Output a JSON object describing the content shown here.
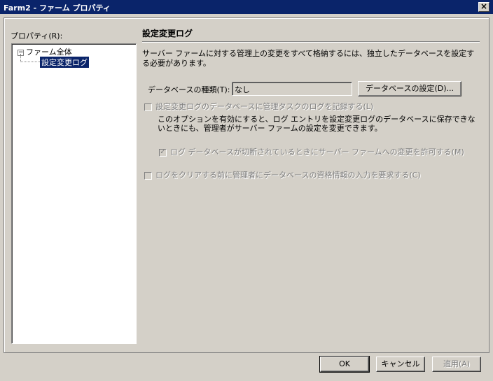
{
  "window": {
    "title": "Farm2 - ファーム プロパティ",
    "close_glyph": "×"
  },
  "left": {
    "label": "プロパティ(R):",
    "tree": {
      "root_label": "ファーム全体",
      "expander": "−",
      "child_label": "設定変更ログ"
    }
  },
  "main": {
    "title": "設定変更ログ",
    "description": "サーバー ファームに対する管理上の変更をすべて格納するには、独立したデータベースを設定する必要があります。",
    "db_type_label": "データベースの種類(T):",
    "db_type_value": "なし",
    "db_settings_button": "データベースの設定(D)...",
    "option_log_admin_tasks": "設定変更ログのデータベースに管理タスクのログを記録する(L)",
    "option_note": "このオプションを有効にすると、ログ エントリを設定変更ログのデータベースに保存できないときにも、管理者がサーバー ファームの設定を変更できます。",
    "option_allow_changes": "ログ データベースが切断されているときにサーバー ファームへの変更を許可する(M)",
    "option_require_credentials": "ログをクリアする前に管理者にデータベースの資格情報の入力を要求する(C)",
    "checkmark": "✓"
  },
  "footer": {
    "ok": "OK",
    "cancel": "キャンセル",
    "apply": "適用(A)"
  }
}
